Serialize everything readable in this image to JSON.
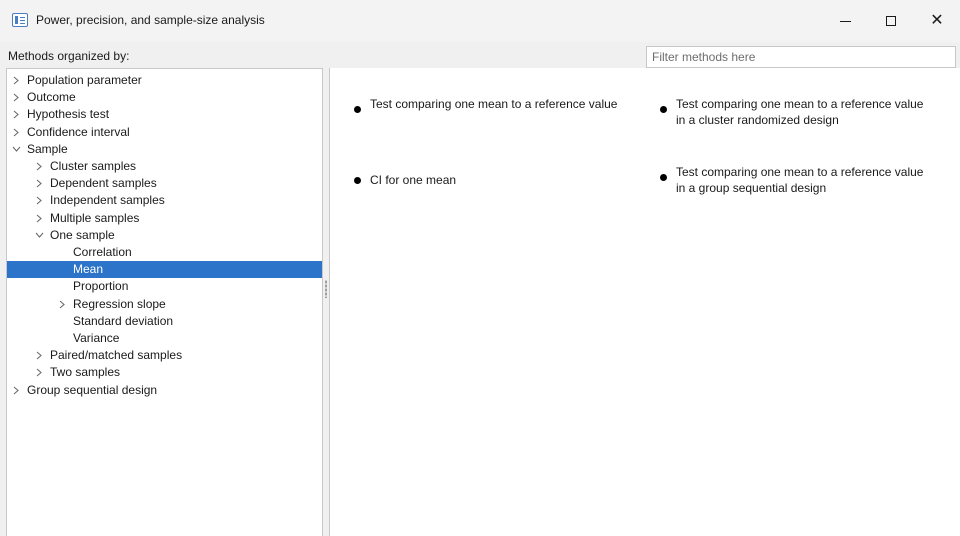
{
  "window": {
    "title": "Power, precision, and sample-size analysis",
    "controls": {
      "minimize": "–",
      "maximize": "☐",
      "close": "✕"
    }
  },
  "panel": {
    "methods_label": "Methods organized by:",
    "filter_placeholder": "Filter methods here",
    "filter_value": ""
  },
  "tree": [
    {
      "label": "Population parameter",
      "expander": "collapsed"
    },
    {
      "label": "Outcome",
      "expander": "collapsed"
    },
    {
      "label": "Hypothesis test",
      "expander": "collapsed"
    },
    {
      "label": "Confidence interval",
      "expander": "collapsed"
    },
    {
      "label": "Sample",
      "expander": "expanded"
    },
    {
      "label": "Cluster samples",
      "expander": "collapsed"
    },
    {
      "label": "Dependent samples",
      "expander": "collapsed"
    },
    {
      "label": "Independent samples",
      "expander": "collapsed"
    },
    {
      "label": "Multiple samples",
      "expander": "collapsed"
    },
    {
      "label": "One sample",
      "expander": "expanded"
    },
    {
      "label": "Correlation",
      "expander": "none"
    },
    {
      "label": "Mean",
      "expander": "none",
      "selected": true
    },
    {
      "label": "Proportion",
      "expander": "none"
    },
    {
      "label": "Regression slope",
      "expander": "collapsed"
    },
    {
      "label": "Standard deviation",
      "expander": "none"
    },
    {
      "label": "Variance",
      "expander": "none"
    },
    {
      "label": "Paired/matched samples",
      "expander": "collapsed"
    },
    {
      "label": "Two samples",
      "expander": "collapsed"
    },
    {
      "label": "Group sequential design",
      "expander": "collapsed"
    }
  ],
  "methods": [
    {
      "text": "Test comparing one mean to a reference value"
    },
    {
      "text": "Test comparing one mean to a reference value in a cluster randomized design"
    },
    {
      "text": "CI for one mean"
    },
    {
      "text": "Test comparing one mean to a reference value in a group sequential design"
    }
  ],
  "colors": {
    "selection": "#2b74c9",
    "window_bg": "#f0f0f0",
    "panel_bg": "#ffffff",
    "border": "#c8c8c8"
  },
  "icons": {
    "app": "app-window-icon",
    "collapsed": "chevron-right-icon",
    "expanded": "chevron-down-icon",
    "bullet": "bullet-dot-icon"
  }
}
